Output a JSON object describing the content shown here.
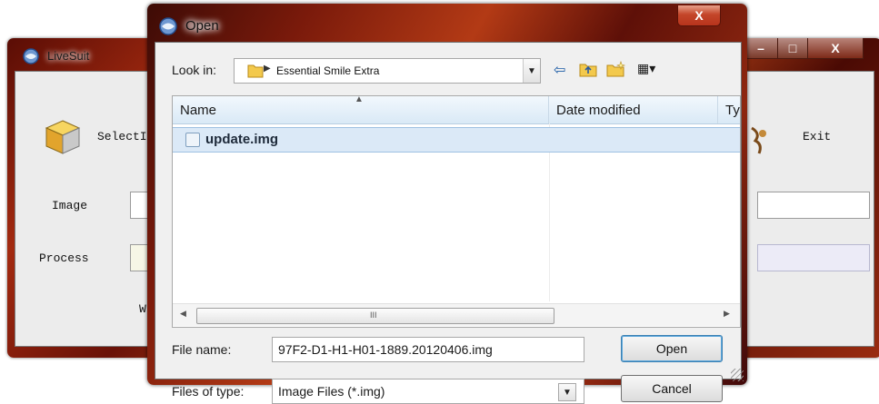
{
  "livesuit": {
    "title": "LiveSuit",
    "select_label": "SelectI",
    "exit_label": "Exit",
    "image_label": "Image",
    "process_label": "Process",
    "partial_label": "W",
    "caption_buttons": {
      "minimize": "–",
      "maximize": "□",
      "close": "X"
    }
  },
  "dialog": {
    "title": "Open",
    "close_glyph": "X",
    "look_in_label": "Look in:",
    "look_in_path": "Essential Smile Extra",
    "toolbar": {
      "back": "⇦",
      "up": "⬆",
      "new_folder": "✳",
      "view": "▦▾"
    },
    "columns": [
      "Name",
      "Date modified",
      "Ty"
    ],
    "files": [
      {
        "name": "update.img"
      }
    ],
    "scrollbar_grip": "III",
    "file_name_label": "File name:",
    "file_name_value": "97F2-D1-H1-H01-1889.20120406.img",
    "files_of_type_label": "Files of type:",
    "files_of_type_value": "Image Files (*.img)",
    "open_button": "Open",
    "cancel_button": "Cancel"
  },
  "colors": {
    "aero_dark": "#5a0d05",
    "aero_mid": "#b33a15",
    "selection": "#dbe9f7",
    "close_red": "#c4462a"
  },
  "icons": [
    "livesuit-app-icon",
    "folder-icon",
    "back-arrow-icon",
    "up-folder-icon",
    "new-folder-icon",
    "view-menu-icon",
    "img-file-icon",
    "sort-up-icon",
    "combo-arrow-icon"
  ]
}
